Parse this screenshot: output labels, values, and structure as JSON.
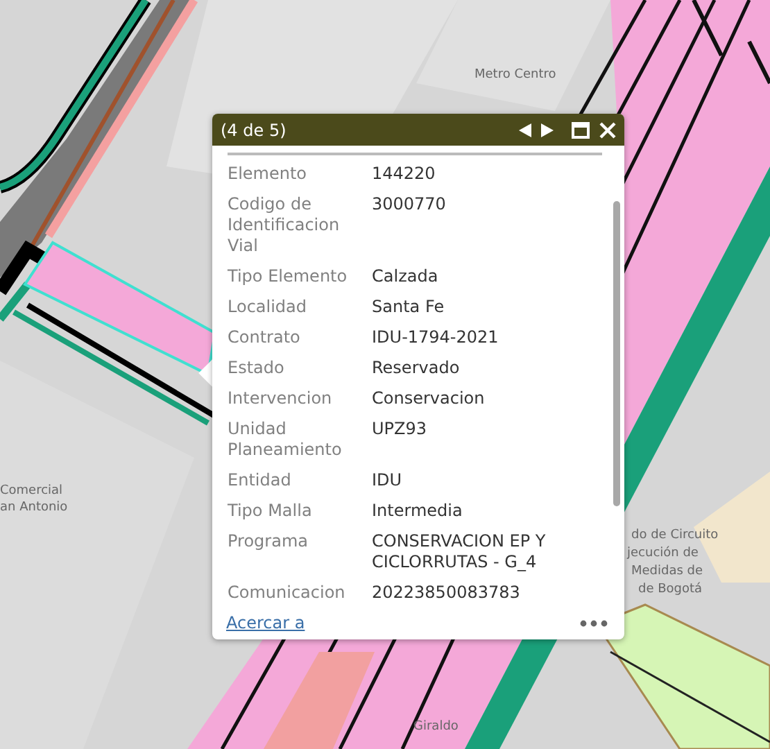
{
  "map_labels": [
    {
      "text": "Metro Centro"
    },
    {
      "text": "Comercial"
    },
    {
      "text": "an Antonio"
    },
    {
      "text": "do de Circuito"
    },
    {
      "text": "jecución de"
    },
    {
      "text": "Medidas de"
    },
    {
      "text": "de Bogotá"
    },
    {
      "text": "Giraldo"
    }
  ],
  "popup": {
    "title": "(4 de 5)",
    "fields": [
      {
        "label": "Elemento",
        "value": "144220"
      },
      {
        "label": "Codigo de Identificacion Vial",
        "value": "3000770"
      },
      {
        "label": "Tipo Elemento",
        "value": "Calzada"
      },
      {
        "label": "Localidad",
        "value": "Santa Fe"
      },
      {
        "label": "Contrato",
        "value": "IDU-1794-2021"
      },
      {
        "label": "Estado",
        "value": "Reservado"
      },
      {
        "label": "Intervencion",
        "value": "Conservacion"
      },
      {
        "label": "Unidad Planeamiento",
        "value": "UPZ93"
      },
      {
        "label": "Entidad",
        "value": "IDU"
      },
      {
        "label": "Tipo Malla",
        "value": "Intermedia"
      },
      {
        "label": "Programa",
        "value": "CONSERVACION EP Y CICLORRUTAS - G_4"
      },
      {
        "label": "Comunicacion",
        "value": "20223850083783"
      }
    ],
    "zoom_link": "Acercar a"
  }
}
